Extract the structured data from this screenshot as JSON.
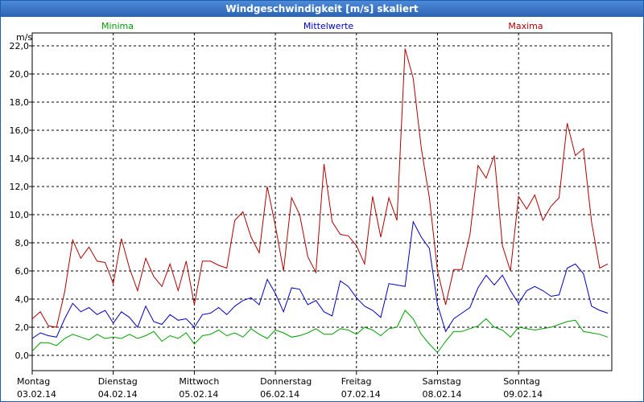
{
  "window": {
    "title": "Windgeschwindigkeit [m/s] skaliert"
  },
  "chart_data": {
    "type": "line",
    "title": "Windgeschwindigkeit [m/s] skaliert",
    "ylabel": "m/s",
    "ylim": [
      0,
      22
    ],
    "yticks": [
      "0,0",
      "2,0",
      "4,0",
      "6,0",
      "8,0",
      "10,0",
      "12,0",
      "14,0",
      "16,0",
      "18,0",
      "20,0",
      "22,0"
    ],
    "ytick_values": [
      0,
      2,
      4,
      6,
      8,
      10,
      12,
      14,
      16,
      18,
      20,
      22
    ],
    "grid": true,
    "legend_placement": "top",
    "colors": {
      "Minima": "#00a000",
      "Mittelwerte": "#0000c0",
      "Maxima": "#b00000",
      "grid": "#000000"
    },
    "xlim": [
      0,
      7.15
    ],
    "day_labels": [
      {
        "x": 0,
        "weekday": "Montag",
        "date": "03.02.14"
      },
      {
        "x": 1,
        "weekday": "Dienstag",
        "date": "04.02.14"
      },
      {
        "x": 2,
        "weekday": "Mittwoch",
        "date": "05.02.14"
      },
      {
        "x": 3,
        "weekday": "Donnerstag",
        "date": "06.02.14"
      },
      {
        "x": 4,
        "weekday": "Freitag",
        "date": "07.02.14"
      },
      {
        "x": 5,
        "weekday": "Samstag",
        "date": "08.02.14"
      },
      {
        "x": 6,
        "weekday": "Sonntag",
        "date": "09.02.14"
      }
    ],
    "series": [
      {
        "name": "Minima",
        "color": "#00a000",
        "points": [
          [
            0,
            0.3
          ],
          [
            0.1,
            0.9
          ],
          [
            0.2,
            0.9
          ],
          [
            0.3,
            0.7
          ],
          [
            0.4,
            1.2
          ],
          [
            0.5,
            1.5
          ],
          [
            0.6,
            1.3
          ],
          [
            0.7,
            1.1
          ],
          [
            0.8,
            1.5
          ],
          [
            0.9,
            1.2
          ],
          [
            1.0,
            1.3
          ],
          [
            1.1,
            1.2
          ],
          [
            1.2,
            1.5
          ],
          [
            1.3,
            1.2
          ],
          [
            1.4,
            1.4
          ],
          [
            1.5,
            1.7
          ],
          [
            1.6,
            1.0
          ],
          [
            1.7,
            1.4
          ],
          [
            1.8,
            1.2
          ],
          [
            1.9,
            1.6
          ],
          [
            2.0,
            0.8
          ],
          [
            2.1,
            1.4
          ],
          [
            2.2,
            1.5
          ],
          [
            2.3,
            1.8
          ],
          [
            2.4,
            1.4
          ],
          [
            2.5,
            1.6
          ],
          [
            2.6,
            1.3
          ],
          [
            2.7,
            1.9
          ],
          [
            2.8,
            1.5
          ],
          [
            2.9,
            1.2
          ],
          [
            3.0,
            1.8
          ],
          [
            3.1,
            1.6
          ],
          [
            3.2,
            1.3
          ],
          [
            3.3,
            1.4
          ],
          [
            3.4,
            1.6
          ],
          [
            3.5,
            1.9
          ],
          [
            3.6,
            1.5
          ],
          [
            3.7,
            1.5
          ],
          [
            3.8,
            1.9
          ],
          [
            3.9,
            1.8
          ],
          [
            4.0,
            1.5
          ],
          [
            4.1,
            2.0
          ],
          [
            4.2,
            1.8
          ],
          [
            4.3,
            1.4
          ],
          [
            4.4,
            1.9
          ],
          [
            4.5,
            2.0
          ],
          [
            4.6,
            3.2
          ],
          [
            4.7,
            2.6
          ],
          [
            4.8,
            1.5
          ],
          [
            4.9,
            0.8
          ],
          [
            5.0,
            0.2
          ],
          [
            5.1,
            1.0
          ],
          [
            5.2,
            1.7
          ],
          [
            5.3,
            1.7
          ],
          [
            5.4,
            1.9
          ],
          [
            5.5,
            2.1
          ],
          [
            5.6,
            2.6
          ],
          [
            5.7,
            2.0
          ],
          [
            5.8,
            1.8
          ],
          [
            5.9,
            1.3
          ],
          [
            6.0,
            2.0
          ],
          [
            6.1,
            1.9
          ],
          [
            6.2,
            1.8
          ],
          [
            6.3,
            1.9
          ],
          [
            6.4,
            2.0
          ],
          [
            6.5,
            2.2
          ],
          [
            6.6,
            2.4
          ],
          [
            6.7,
            2.5
          ],
          [
            6.8,
            1.7
          ],
          [
            6.9,
            1.6
          ],
          [
            7.0,
            1.5
          ],
          [
            7.1,
            1.3
          ]
        ]
      },
      {
        "name": "Mittelwerte",
        "color": "#0000c0",
        "points": [
          [
            0,
            1.2
          ],
          [
            0.1,
            1.6
          ],
          [
            0.2,
            1.4
          ],
          [
            0.3,
            1.3
          ],
          [
            0.4,
            2.6
          ],
          [
            0.5,
            3.7
          ],
          [
            0.6,
            3.1
          ],
          [
            0.7,
            3.4
          ],
          [
            0.8,
            2.9
          ],
          [
            0.9,
            3.2
          ],
          [
            1.0,
            2.3
          ],
          [
            1.1,
            3.1
          ],
          [
            1.2,
            2.7
          ],
          [
            1.3,
            2.0
          ],
          [
            1.4,
            3.5
          ],
          [
            1.5,
            2.4
          ],
          [
            1.6,
            2.2
          ],
          [
            1.7,
            2.9
          ],
          [
            1.8,
            2.5
          ],
          [
            1.9,
            2.6
          ],
          [
            2.0,
            2.0
          ],
          [
            2.1,
            2.9
          ],
          [
            2.2,
            3.0
          ],
          [
            2.3,
            3.4
          ],
          [
            2.4,
            2.9
          ],
          [
            2.5,
            3.5
          ],
          [
            2.6,
            3.9
          ],
          [
            2.7,
            4.1
          ],
          [
            2.8,
            3.6
          ],
          [
            2.9,
            5.4
          ],
          [
            3.0,
            4.4
          ],
          [
            3.1,
            3.1
          ],
          [
            3.2,
            4.8
          ],
          [
            3.3,
            4.7
          ],
          [
            3.4,
            3.6
          ],
          [
            3.5,
            3.9
          ],
          [
            3.6,
            3.1
          ],
          [
            3.7,
            2.8
          ],
          [
            3.8,
            5.3
          ],
          [
            3.9,
            4.9
          ],
          [
            4.0,
            4.1
          ],
          [
            4.1,
            3.5
          ],
          [
            4.2,
            3.2
          ],
          [
            4.3,
            2.7
          ],
          [
            4.4,
            5.1
          ],
          [
            4.5,
            5.0
          ],
          [
            4.6,
            4.9
          ],
          [
            4.7,
            9.5
          ],
          [
            4.8,
            8.4
          ],
          [
            4.9,
            7.6
          ],
          [
            5.0,
            3.6
          ],
          [
            5.1,
            1.7
          ],
          [
            5.2,
            2.6
          ],
          [
            5.3,
            3.0
          ],
          [
            5.4,
            3.4
          ],
          [
            5.5,
            4.8
          ],
          [
            5.6,
            5.7
          ],
          [
            5.7,
            5.0
          ],
          [
            5.8,
            5.7
          ],
          [
            5.9,
            4.6
          ],
          [
            6.0,
            3.7
          ],
          [
            6.1,
            4.6
          ],
          [
            6.2,
            4.9
          ],
          [
            6.3,
            4.6
          ],
          [
            6.4,
            4.2
          ],
          [
            6.5,
            4.3
          ],
          [
            6.6,
            6.2
          ],
          [
            6.7,
            6.5
          ],
          [
            6.8,
            5.8
          ],
          [
            6.9,
            3.5
          ],
          [
            7.0,
            3.2
          ],
          [
            7.1,
            3.0
          ]
        ]
      },
      {
        "name": "Maxima",
        "color": "#b00000",
        "points": [
          [
            0,
            2.6
          ],
          [
            0.1,
            3.1
          ],
          [
            0.2,
            2.1
          ],
          [
            0.3,
            2.0
          ],
          [
            0.4,
            4.5
          ],
          [
            0.5,
            8.2
          ],
          [
            0.6,
            6.9
          ],
          [
            0.7,
            7.7
          ],
          [
            0.8,
            6.7
          ],
          [
            0.9,
            6.6
          ],
          [
            1.0,
            5.1
          ],
          [
            1.1,
            8.3
          ],
          [
            1.2,
            6.2
          ],
          [
            1.3,
            4.6
          ],
          [
            1.4,
            6.9
          ],
          [
            1.5,
            5.6
          ],
          [
            1.6,
            4.9
          ],
          [
            1.7,
            6.5
          ],
          [
            1.8,
            4.6
          ],
          [
            1.9,
            6.7
          ],
          [
            2.0,
            3.6
          ],
          [
            2.1,
            6.7
          ],
          [
            2.2,
            6.7
          ],
          [
            2.3,
            6.4
          ],
          [
            2.4,
            6.2
          ],
          [
            2.5,
            9.6
          ],
          [
            2.6,
            10.2
          ],
          [
            2.7,
            8.4
          ],
          [
            2.8,
            7.3
          ],
          [
            2.9,
            12.0
          ],
          [
            3.0,
            9.2
          ],
          [
            3.1,
            6.0
          ],
          [
            3.2,
            11.2
          ],
          [
            3.3,
            10.0
          ],
          [
            3.4,
            7.0
          ],
          [
            3.5,
            5.9
          ],
          [
            3.6,
            13.6
          ],
          [
            3.7,
            9.5
          ],
          [
            3.8,
            8.6
          ],
          [
            3.9,
            8.5
          ],
          [
            4.0,
            7.8
          ],
          [
            4.1,
            6.5
          ],
          [
            4.2,
            11.3
          ],
          [
            4.3,
            8.4
          ],
          [
            4.4,
            11.2
          ],
          [
            4.5,
            9.6
          ],
          [
            4.6,
            21.8
          ],
          [
            4.7,
            19.7
          ],
          [
            4.8,
            14.7
          ],
          [
            4.9,
            11.2
          ],
          [
            5.0,
            6.0
          ],
          [
            5.1,
            3.6
          ],
          [
            5.2,
            6.1
          ],
          [
            5.3,
            6.1
          ],
          [
            5.4,
            8.6
          ],
          [
            5.5,
            13.5
          ],
          [
            5.6,
            12.6
          ],
          [
            5.7,
            14.2
          ],
          [
            5.8,
            7.8
          ],
          [
            5.9,
            6.0
          ],
          [
            6.0,
            11.3
          ],
          [
            6.1,
            10.4
          ],
          [
            6.2,
            11.4
          ],
          [
            6.3,
            9.6
          ],
          [
            6.4,
            10.6
          ],
          [
            6.5,
            11.2
          ],
          [
            6.6,
            16.5
          ],
          [
            6.7,
            14.2
          ],
          [
            6.8,
            14.7
          ],
          [
            6.9,
            9.5
          ],
          [
            7.0,
            6.2
          ],
          [
            7.1,
            6.5
          ]
        ]
      }
    ]
  }
}
